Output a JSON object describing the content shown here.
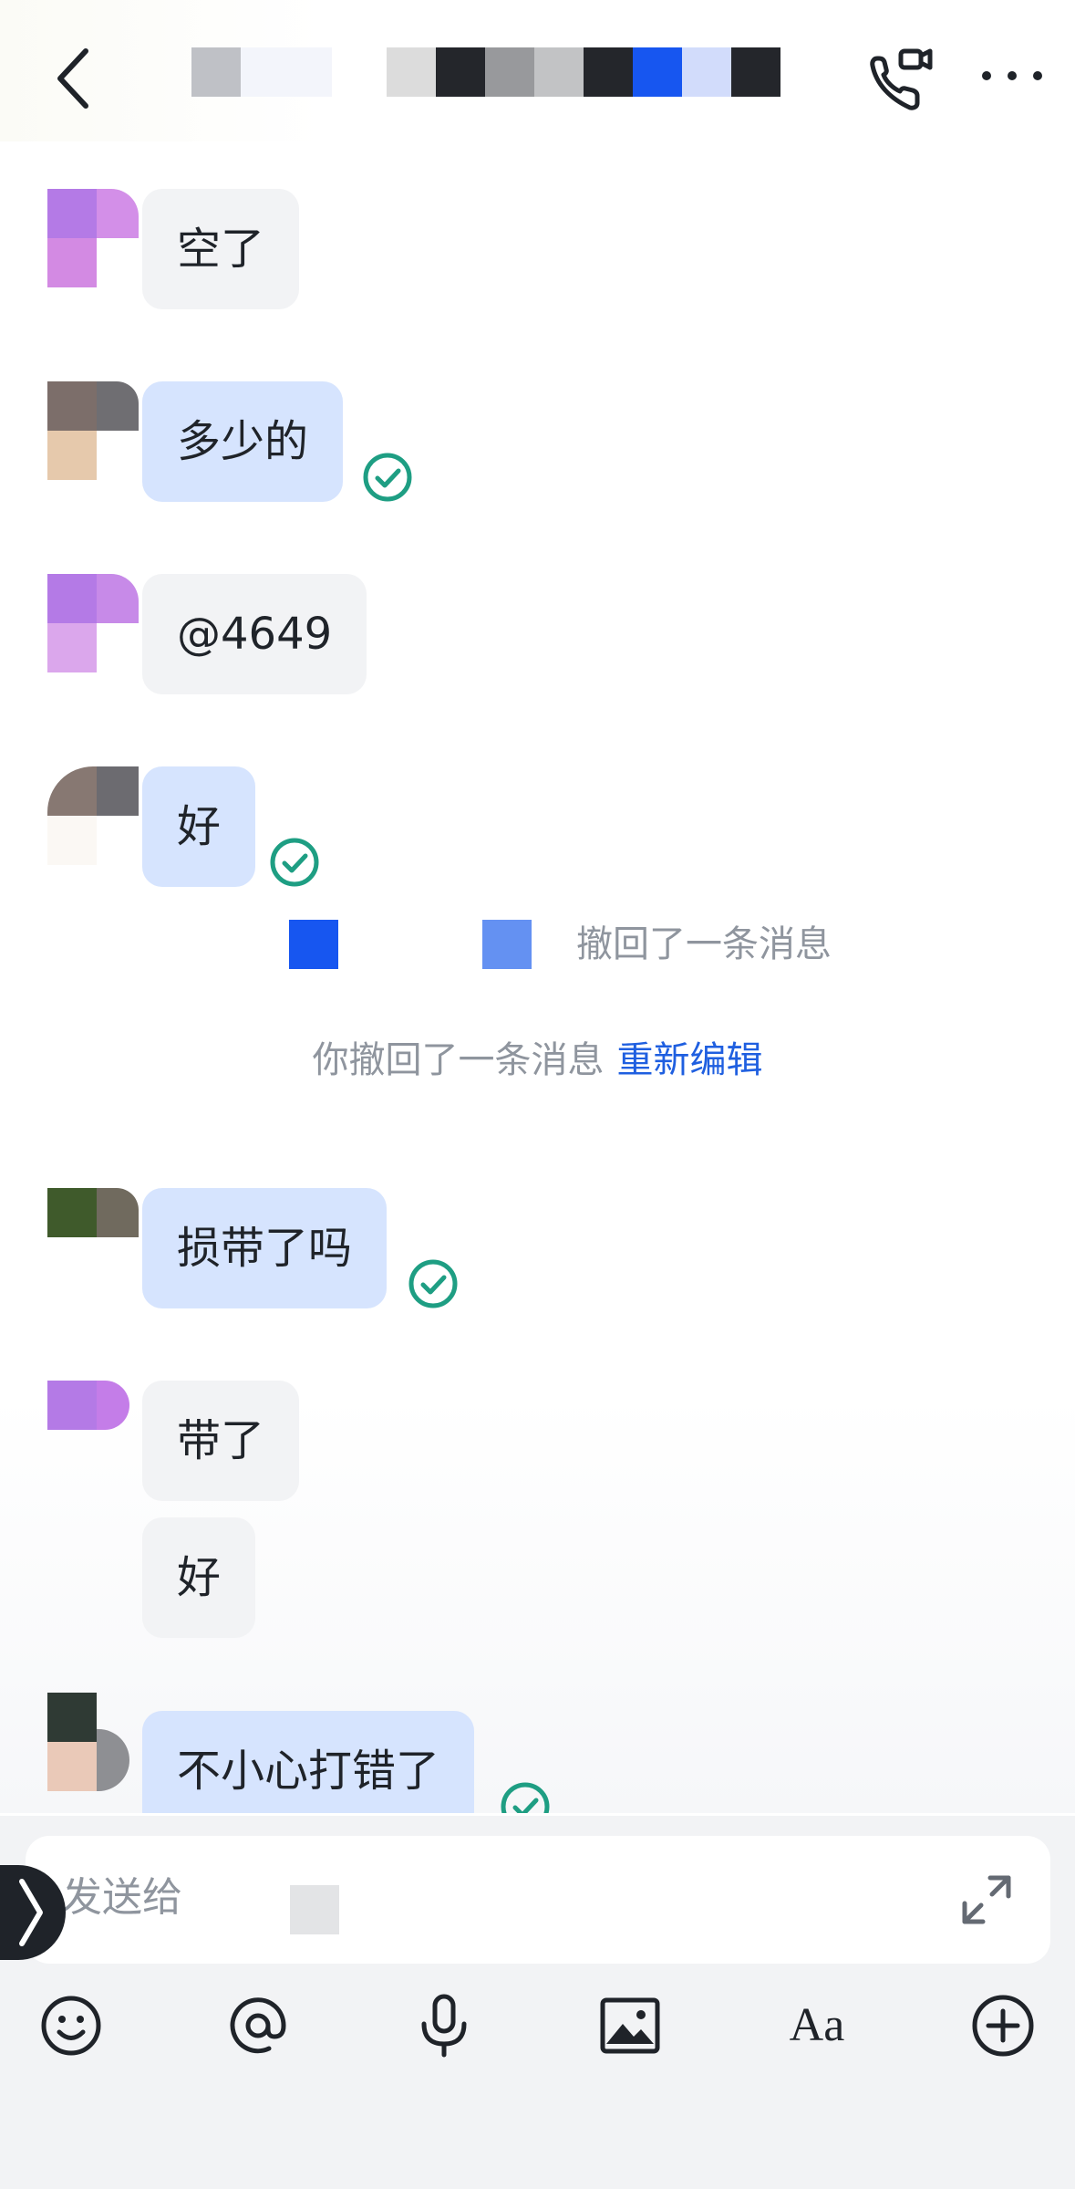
{
  "header": {
    "back_icon": "chevron-left-icon",
    "call_icon": "phone-video-icon",
    "more_icon": "more-horizontal-icon",
    "title_redacted": true
  },
  "messages": [
    {
      "id": "m1",
      "direction": "in",
      "text": "空了",
      "read": false
    },
    {
      "id": "m2",
      "direction": "out",
      "text": "多少的",
      "read": true
    },
    {
      "id": "m3",
      "direction": "in",
      "text": "@4649",
      "read": false
    },
    {
      "id": "m4",
      "direction": "out",
      "text": "好",
      "read": true
    },
    {
      "id": "m5",
      "direction": "out",
      "text": "损带了吗",
      "read": true
    },
    {
      "id": "m6",
      "direction": "in",
      "text": "带了",
      "read": false
    },
    {
      "id": "m7",
      "direction": "in",
      "text": "好",
      "read": false
    },
    {
      "id": "m8",
      "direction": "out",
      "text": "不小心打错了",
      "read": true
    }
  ],
  "system": {
    "other_recalled": "撤回了一条消息",
    "self_recalled": "你撤回了一条消息",
    "reedit_label": "重新编辑"
  },
  "composer": {
    "placeholder": "发送给",
    "expand_icon": "expand-icon",
    "toolbar": [
      {
        "name": "emoji",
        "icon": "emoji-icon"
      },
      {
        "name": "mention",
        "icon": "at-icon"
      },
      {
        "name": "voice",
        "icon": "microphone-icon"
      },
      {
        "name": "image",
        "icon": "image-icon"
      },
      {
        "name": "format",
        "icon": "text-format-icon",
        "label": "Aa"
      },
      {
        "name": "more",
        "icon": "plus-circle-icon"
      }
    ]
  },
  "colors": {
    "outgoing_bubble": "#d6e4fe",
    "incoming_bubble": "#f2f3f5",
    "read_check": "#1e9e83",
    "link_blue": "#1f5fe0",
    "system_text": "#8f959e"
  }
}
